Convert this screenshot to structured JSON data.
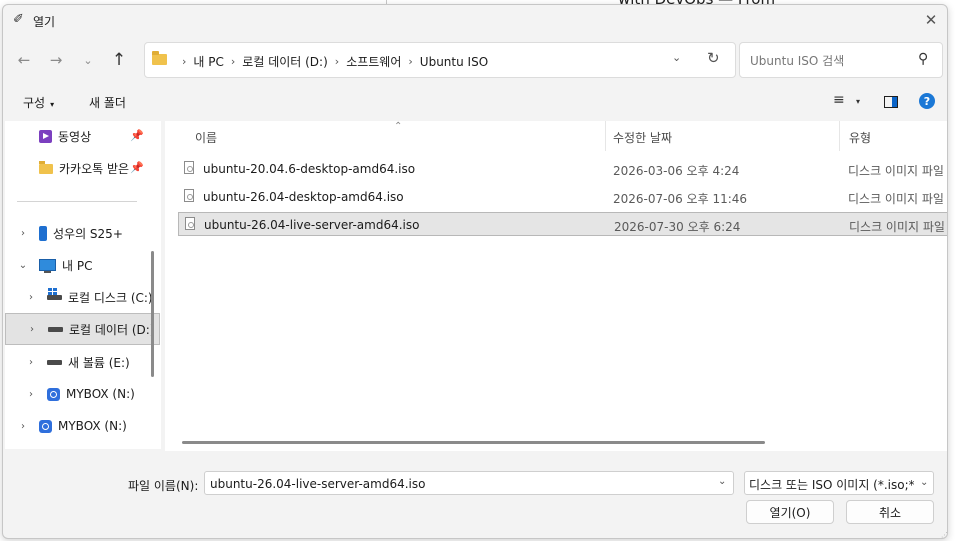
{
  "background": {
    "partial_text": "with DevOps — From"
  },
  "window": {
    "title": "열기",
    "close_glyph": "✕"
  },
  "nav": {
    "back": "←",
    "forward": "→",
    "recent": "⌄",
    "up": "↑"
  },
  "address": {
    "crumbs": [
      "내 PC",
      "로컬 데이터 (D:)",
      "소프트웨어",
      "Ubuntu ISO"
    ],
    "separator": "›",
    "dropdown_glyph": "⌄",
    "refresh_glyph": "↻"
  },
  "search": {
    "placeholder": "Ubuntu ISO 검색"
  },
  "toolbar": {
    "organize_label": "구성",
    "organize_caret": "▾",
    "new_folder_label": "새 폴더",
    "view_glyph": "≡",
    "view_caret": "▾",
    "help_glyph": "?"
  },
  "sidebar": {
    "pinned": [
      {
        "label": "동영상",
        "icon": "video-icon"
      },
      {
        "label": "카카오톡 받은",
        "icon": "folder-icon"
      }
    ],
    "pin_glyph": "📌",
    "items": [
      {
        "label": "성우의 S25+",
        "icon": "phone-icon"
      },
      {
        "label": "내 PC",
        "icon": "pc-icon"
      },
      {
        "label": "로컬 디스크 (C:)",
        "icon": "drive-icon"
      },
      {
        "label": "로컬 데이터 (D:)",
        "icon": "drive-icon"
      },
      {
        "label": "새 볼륨 (E:)",
        "icon": "drive-icon"
      },
      {
        "label": "MYBOX (N:)",
        "icon": "mybox-icon"
      },
      {
        "label": "MYBOX (N:)",
        "icon": "mybox-icon"
      }
    ],
    "chevron_right": "›",
    "chevron_down": "⌄"
  },
  "columns": {
    "name": "이름",
    "modified": "수정한 날짜",
    "type": "유형",
    "sort_glyph": "⌃"
  },
  "files": [
    {
      "name": "ubuntu-20.04.6-desktop-amd64.iso",
      "modified": "2026-03-06 오후 4:24",
      "type": "디스크 이미지 파일"
    },
    {
      "name": "ubuntu-26.04-desktop-amd64.iso",
      "modified": "2026-07-06 오후 11:46",
      "type": "디스크 이미지 파일"
    },
    {
      "name": "ubuntu-26.04-live-server-amd64.iso",
      "modified": "2026-07-30 오후 6:24",
      "type": "디스크 이미지 파일"
    }
  ],
  "selected_file_index": 2,
  "footer": {
    "filename_label": "파일 이름(N):",
    "filename_value": "ubuntu-26.04-live-server-amd64.iso",
    "filter_value": "디스크 또는 ISO 이미지 (*.iso;*.img)",
    "open_label": "열기(O)",
    "cancel_label": "취소",
    "caret": "⌄"
  }
}
